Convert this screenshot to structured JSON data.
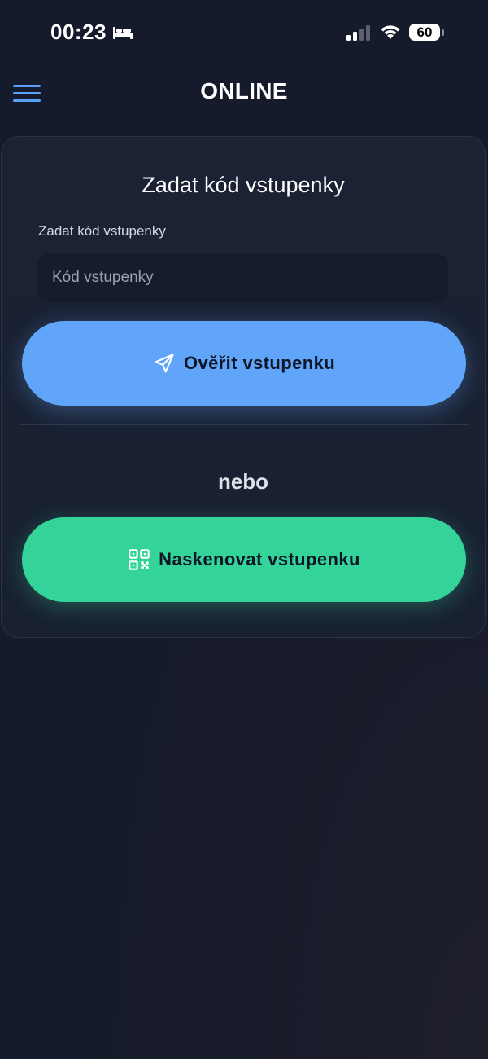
{
  "status_bar": {
    "time": "00:23",
    "battery_level": "60",
    "icons": [
      "bed-icon",
      "cellular-signal-icon",
      "wifi-icon",
      "battery-icon"
    ]
  },
  "header": {
    "title": "ONLINE",
    "menu_icon": "hamburger-menu-icon"
  },
  "card": {
    "title": "Zadat kód vstupenky",
    "field_label": "Zadat kód vstupenky",
    "input_placeholder": "Kód vstupenky",
    "input_value": "",
    "verify_button_label": "Ověřit vstupenku",
    "verify_icon": "send-icon",
    "or_text": "nebo",
    "scan_button_label": "Naskenovat vstupenku",
    "scan_icon": "qr-code-icon"
  },
  "colors": {
    "accent_blue": "#60a5fa",
    "accent_green": "#34d399",
    "menu_icon": "#5aa0f8",
    "background": "#171b2a"
  }
}
